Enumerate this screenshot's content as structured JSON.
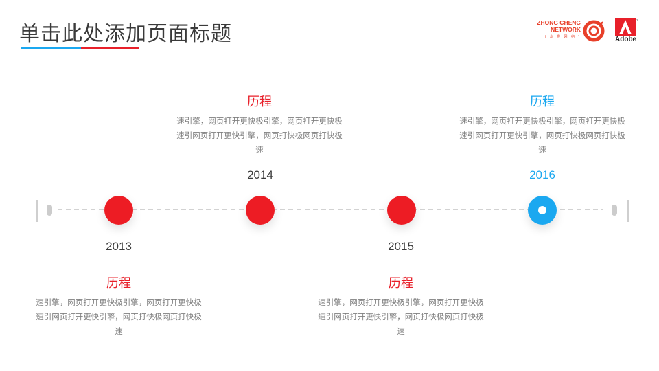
{
  "header": {
    "title": "单击此处添加页面标题",
    "logo_zc_line1": "ZHONG CHENG",
    "logo_zc_line2": "NETWORK",
    "logo_zc_sub": "( 众 橙 网 络 )",
    "logo_adobe": "Adobe"
  },
  "colors": {
    "red": "#ed1c24",
    "blue": "#1ba8f0",
    "text_gray": "#7f7f7f",
    "title": "#3a3a3a"
  },
  "milestones": [
    {
      "year": "2013",
      "title": "历程",
      "body": "速引擎，网页打开更快极引擎，网页打开更快极速引网页打开更快引擎，网页打快极网页打快极速",
      "color": "red"
    },
    {
      "year": "2014",
      "title": "历程",
      "body": "速引擎，网页打开更快极引擎，网页打开更快极速引网页打开更快引擎，网页打快极网页打快极速",
      "color": "red"
    },
    {
      "year": "2015",
      "title": "历程",
      "body": "速引擎，网页打开更快极引擎，网页打开更快极速引网页打开更快引擎，网页打快极网页打快极速",
      "color": "red"
    },
    {
      "year": "2016",
      "title": "历程",
      "body": "速引擎，网页打开更快极引擎，网页打开更快极速引网页打开更快引擎，网页打快极网页打快极速",
      "color": "blue"
    }
  ]
}
